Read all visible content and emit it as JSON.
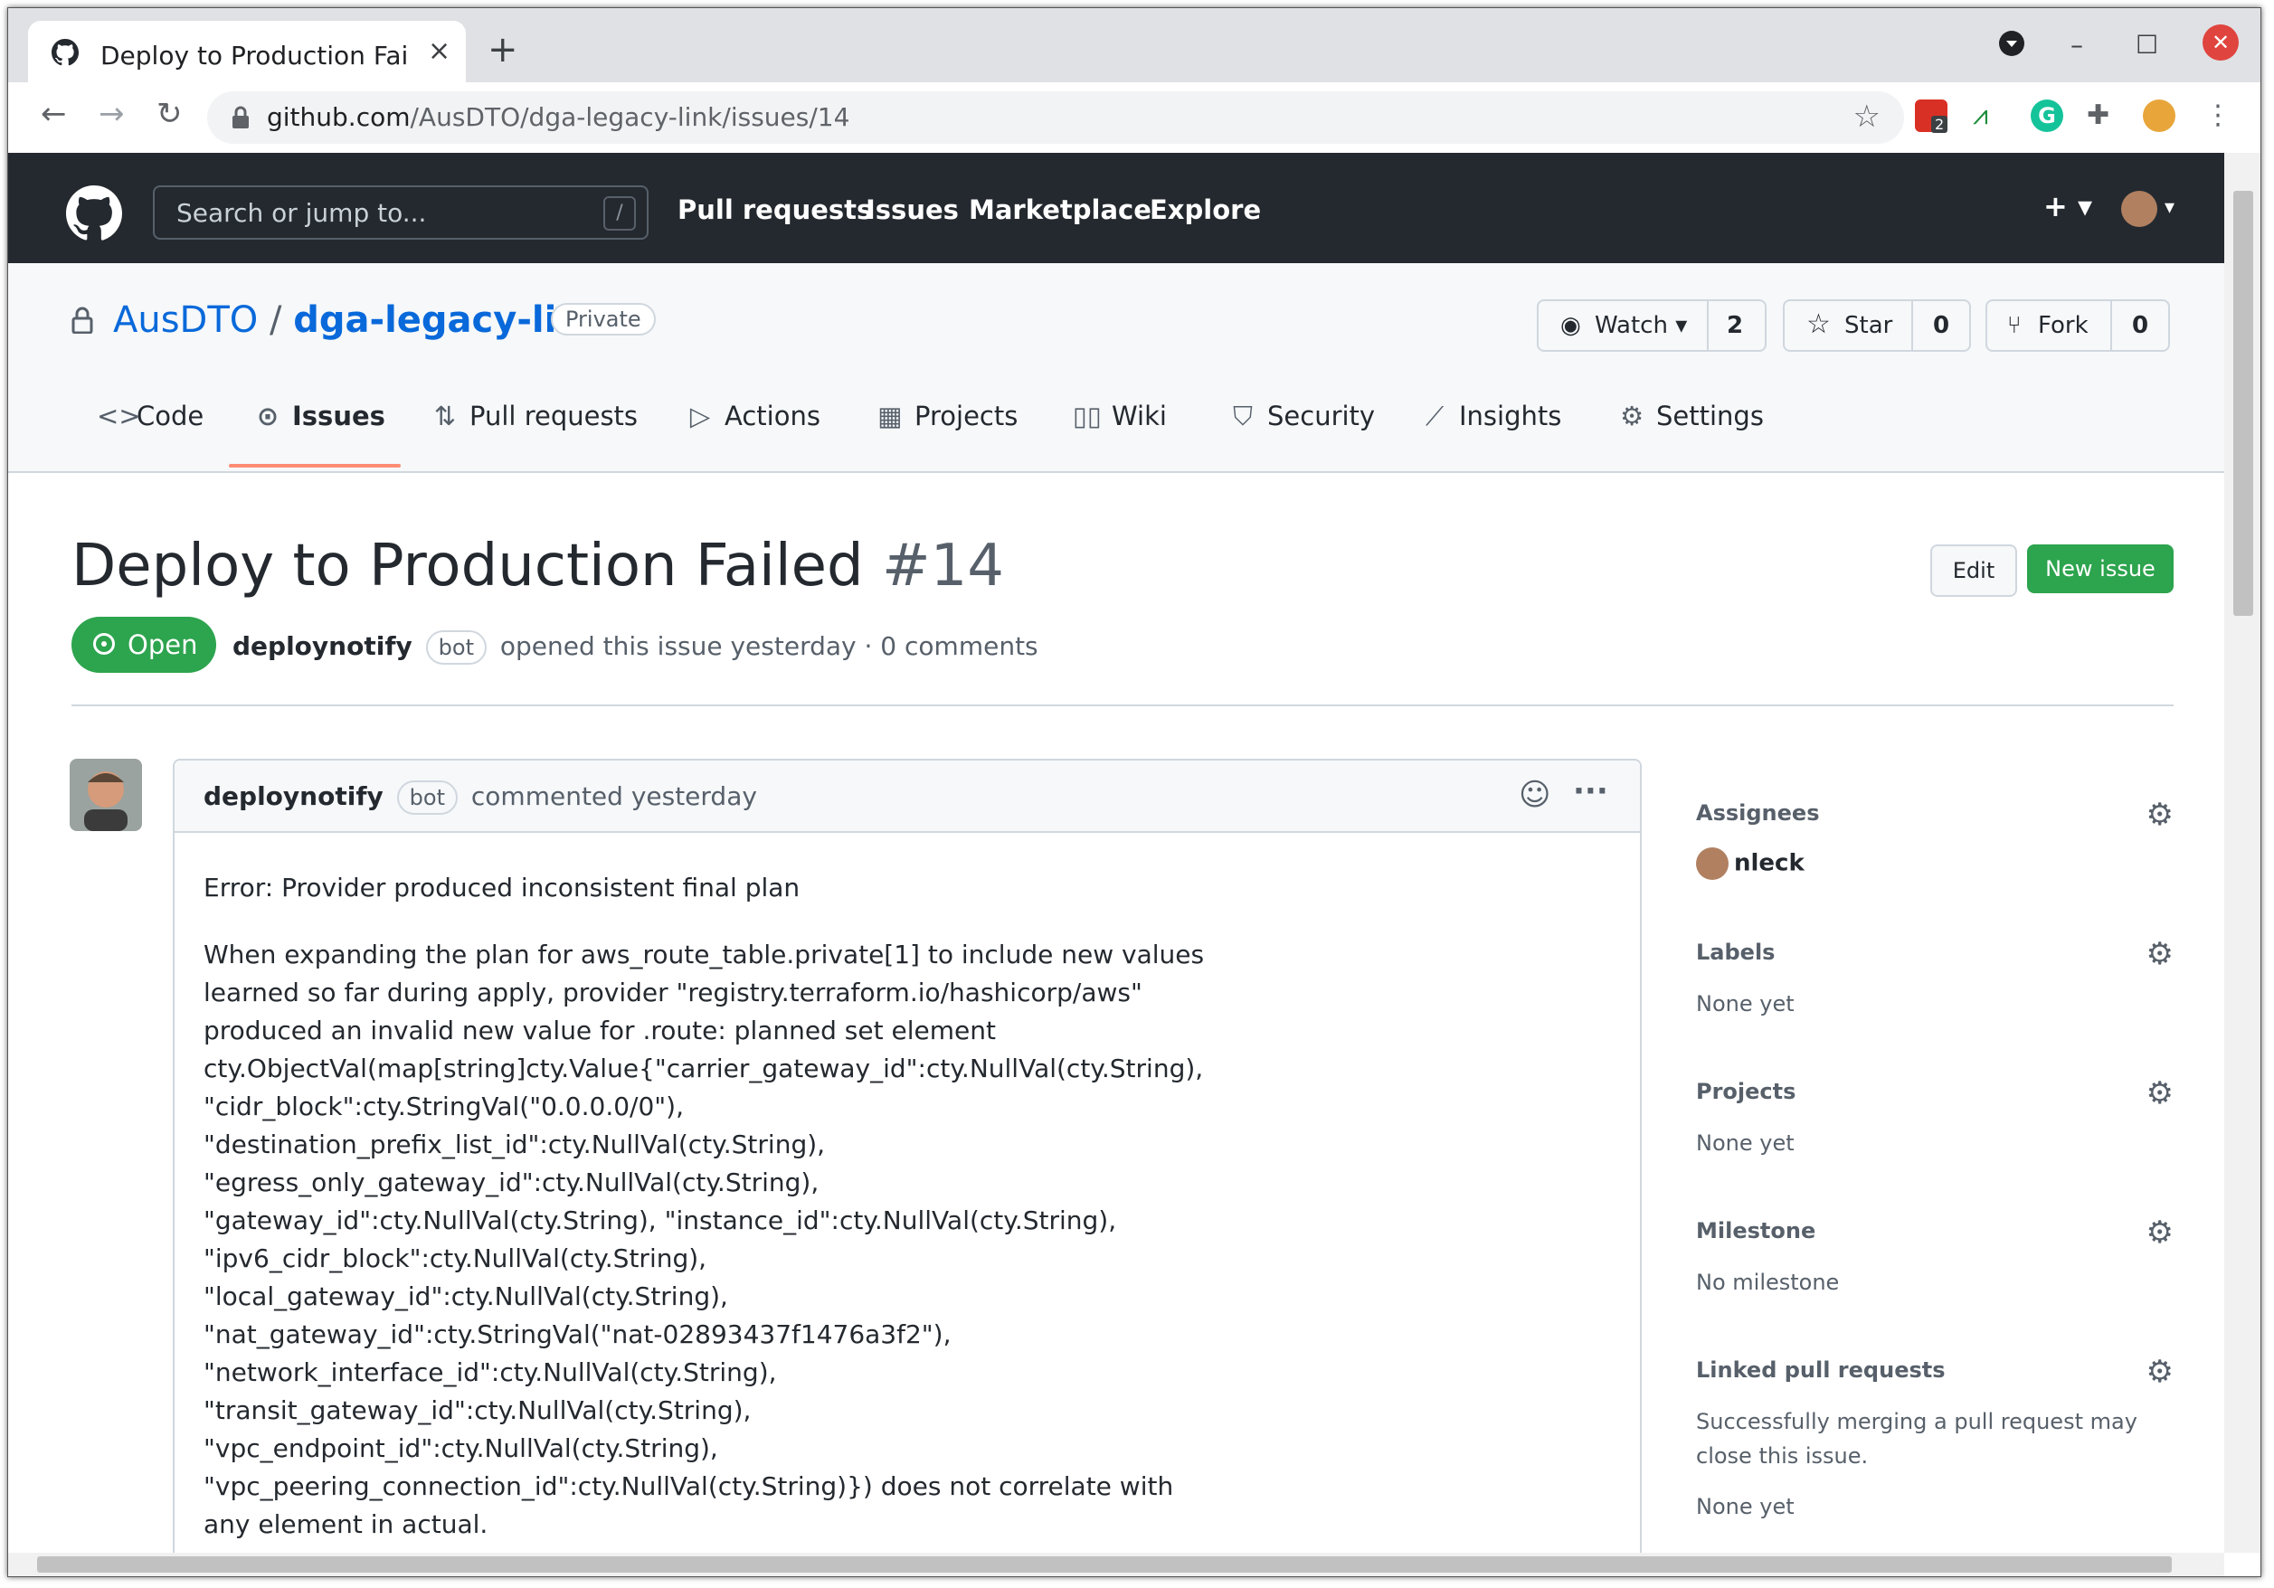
{
  "browser": {
    "tab_title": "Deploy to Production Failed",
    "new_tab": "+",
    "close_tab": "×",
    "url_host": "github.com",
    "url_path": "/AusDTO/dga-legacy-link/issues/14",
    "extension_badge": "2",
    "window_controls": {
      "minimize": "–",
      "maximize": "☐",
      "close": "✕"
    },
    "nav": {
      "back": "←",
      "forward": "→",
      "reload": "↻"
    }
  },
  "github_header": {
    "search_placeholder": "Search or jump to...",
    "search_key": "/",
    "nav": [
      "Pull requests",
      "Issues",
      "Marketplace",
      "Explore"
    ],
    "plus": "+ ▾"
  },
  "repo": {
    "owner": "AusDTO",
    "sep": "/",
    "name": "dga-legacy-link",
    "visibility": "Private",
    "watch": {
      "label": "Watch ▾",
      "count": "2"
    },
    "star": {
      "label": "Star",
      "count": "0"
    },
    "fork": {
      "label": "Fork",
      "count": "0"
    },
    "tabs": [
      {
        "label": "Code",
        "icon": "code-icon",
        "glyph": "<>"
      },
      {
        "label": "Issues",
        "icon": "issue-icon",
        "glyph": "⊙"
      },
      {
        "label": "Pull requests",
        "icon": "pull-request-icon",
        "glyph": "⇅"
      },
      {
        "label": "Actions",
        "icon": "play-icon",
        "glyph": "▷"
      },
      {
        "label": "Projects",
        "icon": "project-icon",
        "glyph": "▦"
      },
      {
        "label": "Wiki",
        "icon": "book-icon",
        "glyph": "▯▯"
      },
      {
        "label": "Security",
        "icon": "shield-icon",
        "glyph": "⛉"
      },
      {
        "label": "Insights",
        "icon": "graph-icon",
        "glyph": "⟋"
      },
      {
        "label": "Settings",
        "icon": "gear-icon",
        "glyph": "⚙"
      }
    ],
    "active_tab": "Issues"
  },
  "issue": {
    "title": "Deploy to Production Failed",
    "number": "#14",
    "edit_label": "Edit",
    "new_issue_label": "New issue",
    "state": "Open",
    "author": "deploynotify",
    "author_badge": "bot",
    "meta_text": "opened this issue yesterday · 0 comments"
  },
  "comment": {
    "author": "deploynotify",
    "author_badge": "bot",
    "action": "commented yesterday",
    "more": "···",
    "body_p1": "Error: Provider produced inconsistent final plan",
    "body_p2": "When expanding the plan for aws_route_table.private[1] to include new values\nlearned so far during apply, provider \"registry.terraform.io/hashicorp/aws\"\nproduced an invalid new value for .route: planned set element\ncty.ObjectVal(map[string]cty.Value{\"carrier_gateway_id\":cty.NullVal(cty.String),\n\"cidr_block\":cty.StringVal(\"0.0.0.0/0\"),\n\"destination_prefix_list_id\":cty.NullVal(cty.String),\n\"egress_only_gateway_id\":cty.NullVal(cty.String),\n\"gateway_id\":cty.NullVal(cty.String), \"instance_id\":cty.NullVal(cty.String),\n\"ipv6_cidr_block\":cty.NullVal(cty.String),\n\"local_gateway_id\":cty.NullVal(cty.String),\n\"nat_gateway_id\":cty.StringVal(\"nat-02893437f1476a3f2\"),\n\"network_interface_id\":cty.NullVal(cty.String),\n\"transit_gateway_id\":cty.NullVal(cty.String),\n\"vpc_endpoint_id\":cty.NullVal(cty.String),\n\"vpc_peering_connection_id\":cty.NullVal(cty.String)}) does not correlate with\nany element in actual."
  },
  "sidebar": {
    "assignees": {
      "heading": "Assignees",
      "value": "nleck"
    },
    "labels": {
      "heading": "Labels",
      "value": "None yet"
    },
    "projects": {
      "heading": "Projects",
      "value": "None yet"
    },
    "milestone": {
      "heading": "Milestone",
      "value": "No milestone"
    },
    "linked_prs": {
      "heading": "Linked pull requests",
      "note": "Successfully merging a pull request may close this issue.",
      "value": "None yet"
    }
  },
  "colors": {
    "header_bg": "#24292f",
    "link": "#0969da",
    "green": "#2da44e",
    "tab_underline": "#fd8c73",
    "close_red": "#e0443e"
  }
}
